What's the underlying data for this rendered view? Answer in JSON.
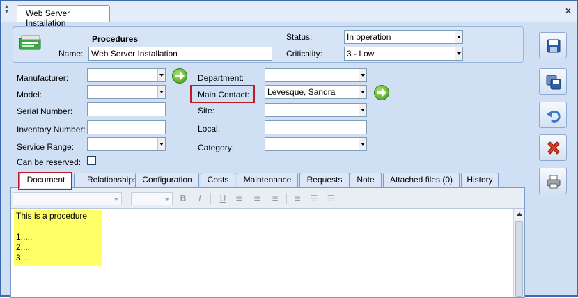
{
  "window": {
    "tab_title": "Web Server Installation",
    "close_glyph": "×"
  },
  "header": {
    "section_title": "Procedures",
    "name_label": "Name:",
    "name_value": "Web Server Installation",
    "status_label": "Status:",
    "status_value": "In operation",
    "criticality_label": "Criticality:",
    "criticality_value": "3 - Low"
  },
  "form": {
    "manufacturer_label": "Manufacturer:",
    "manufacturer_value": "",
    "model_label": "Model:",
    "model_value": "",
    "serial_label": "Serial Number:",
    "serial_value": "",
    "inventory_label": "Inventory Number:",
    "inventory_value": "",
    "service_range_label": "Service Range:",
    "service_range_value": "",
    "reservable_label": "Can be reserved:",
    "reservable_checked": false,
    "department_label": "Department:",
    "department_value": "",
    "main_contact_label": "Main Contact:",
    "main_contact_value": "Levesque, Sandra",
    "site_label": "Site:",
    "site_value": "",
    "local_label": "Local:",
    "local_value": "",
    "category_label": "Category:",
    "category_value": ""
  },
  "tabs": [
    {
      "label": "Document",
      "active": true
    },
    {
      "label": "Relationships"
    },
    {
      "label": "Configuration"
    },
    {
      "label": "Costs"
    },
    {
      "label": "Maintenance"
    },
    {
      "label": "Requests"
    },
    {
      "label": "Note"
    },
    {
      "label": "Attached files (0)"
    },
    {
      "label": "History"
    }
  ],
  "editor": {
    "lines": [
      "This is a procedure",
      "",
      "1.....",
      "2....",
      "3...."
    ],
    "toolbar": {
      "bold": "B",
      "italic": "I",
      "underline": "U",
      "align_left": "≡",
      "align_center": "≡",
      "align_right": "≡",
      "justify": "≡",
      "bullets": "☰",
      "numbers": "☰"
    }
  },
  "sidebar_buttons": [
    {
      "icon": "save-icon"
    },
    {
      "icon": "save-as-icon"
    },
    {
      "icon": "undo-icon"
    },
    {
      "icon": "delete-icon"
    },
    {
      "icon": "print-icon"
    }
  ],
  "colors": {
    "highlight": "#c0182a",
    "editor_highlight": "#ffff66",
    "panel": "#d6e4f6"
  }
}
